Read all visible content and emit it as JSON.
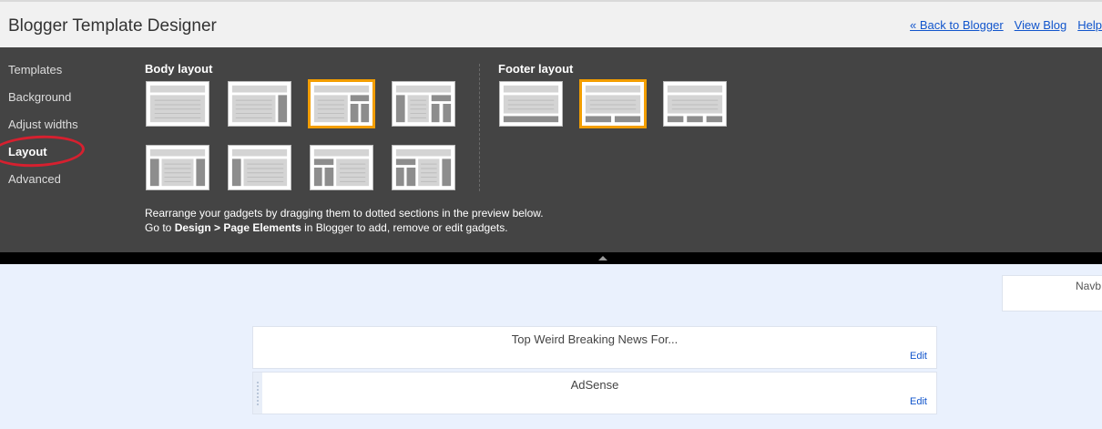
{
  "header": {
    "title": "Blogger Template Designer",
    "links": [
      "« Back to Blogger",
      "View Blog",
      "Help"
    ]
  },
  "nav": {
    "items": [
      "Templates",
      "Background",
      "Adjust widths",
      "Layout",
      "Advanced"
    ],
    "active": "Layout"
  },
  "body_layout": {
    "title": "Body layout",
    "selected_index": 2,
    "options": [
      "right-sidebar",
      "right-sidebar-narrow",
      "right-two-column",
      "left-two-column",
      "both-sidebars",
      "left-sidebar",
      "left-stacked",
      "left-stacked-right"
    ]
  },
  "footer_layout": {
    "title": "Footer layout",
    "selected_index": 1,
    "options": [
      "one-column",
      "two-columns",
      "three-columns"
    ]
  },
  "info": {
    "line1": "Rearrange your gadgets by dragging them to dotted sections in the preview below.",
    "line2_prefix": "Go to ",
    "line2_bold": "Design > Page Elements",
    "line2_suffix": " in Blogger to add, remove or edit gadgets."
  },
  "preview": {
    "navbar_label": "Navb",
    "gadgets": [
      {
        "title": "Top Weird Breaking News For...",
        "edit": "Edit"
      },
      {
        "title": "AdSense",
        "edit": "Edit"
      }
    ]
  },
  "colors": {
    "panel_bg": "#444444",
    "selected_border": "#f39e00",
    "link": "#1155cc",
    "annotation_circle": "#d6202f"
  }
}
